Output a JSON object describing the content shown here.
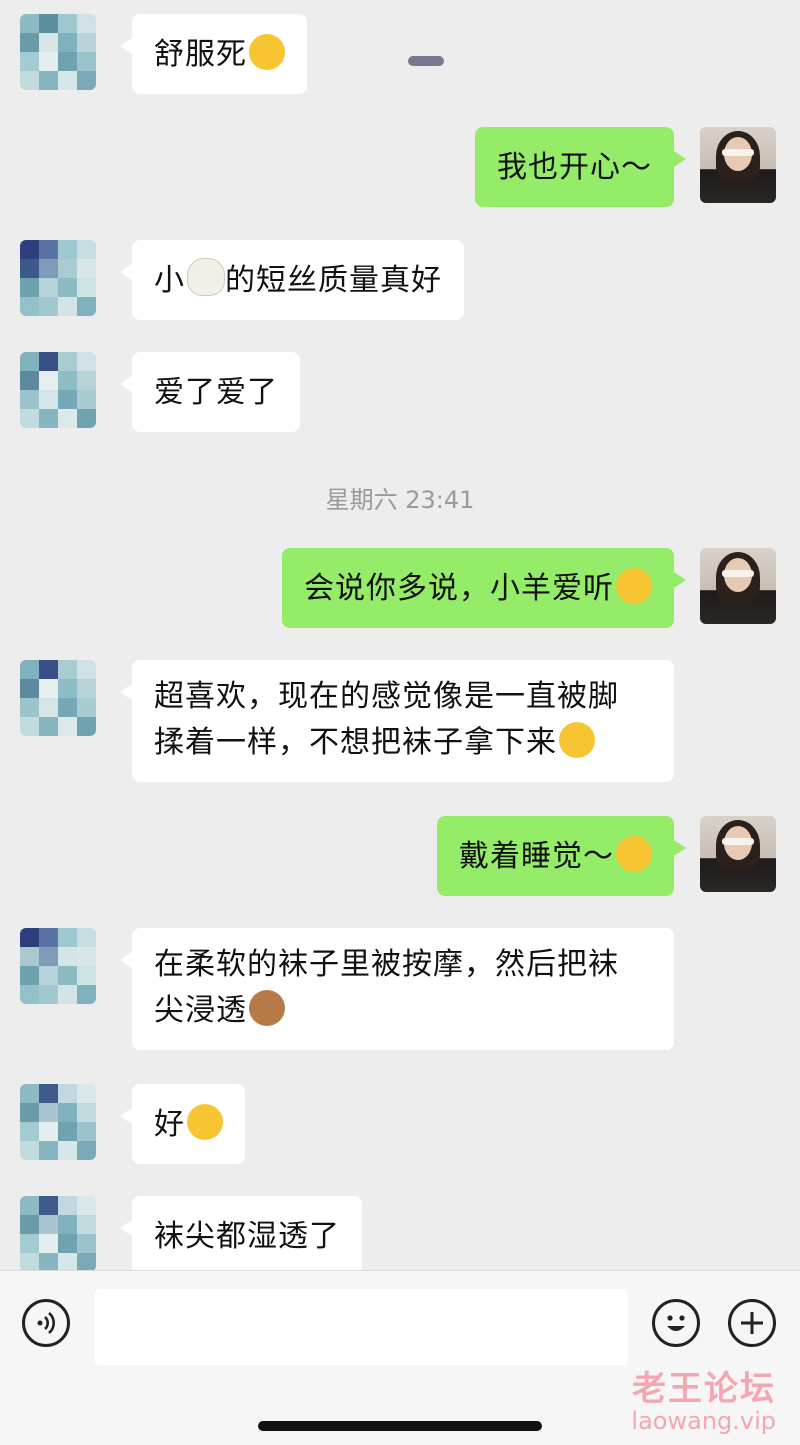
{
  "messages": [
    {
      "side": "in",
      "text": "舒服死",
      "emoji": "face-stars-icon"
    },
    {
      "side": "out",
      "text": "我也开心～"
    },
    {
      "side": "in",
      "text_before": "小",
      "emoji": "sheep-icon",
      "text_after": "的短丝质量真好"
    },
    {
      "side": "in",
      "text": "爱了爱了"
    },
    {
      "side": "out",
      "text": "会说你多说，小羊爱听",
      "emoji": "kissing-face-icon"
    },
    {
      "side": "in",
      "line1": "超喜欢，现在的感觉像是一直被脚",
      "line2": "揉着一样，不想把袜子拿下来",
      "emoji": "laughing-crying-face-icon"
    },
    {
      "side": "out",
      "text": "戴着睡觉～",
      "emoji": "winking-tongue-face-icon"
    },
    {
      "side": "in",
      "line1": "在柔软的袜子里被按摩，然后把袜",
      "line2": "尖浸透",
      "emoji": "see-no-evil-monkey-icon"
    },
    {
      "side": "in",
      "text": "好",
      "emoji": "blushing-face-icon"
    },
    {
      "side": "in",
      "text": "袜尖都湿透了"
    }
  ],
  "timestamp": "星期六 23:41",
  "watermark": {
    "cn": "老王论坛",
    "url": "laowang.vip"
  },
  "icons": {
    "voice": "voice-icon",
    "emoji": "smiley-icon",
    "add": "plus-icon"
  },
  "colors": {
    "incoming": "#ffffff",
    "outgoing": "#95ec69",
    "background": "#ededed"
  }
}
